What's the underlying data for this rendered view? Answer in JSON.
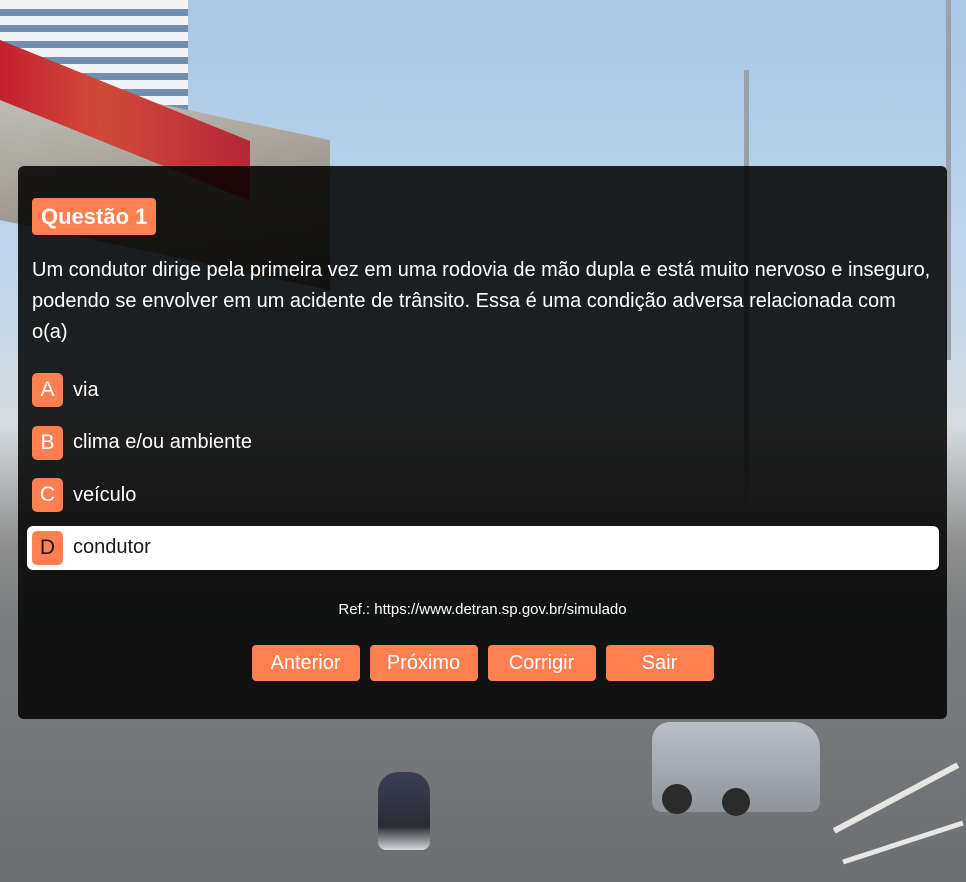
{
  "quiz": {
    "question_label": "Questão 1",
    "question_text": "Um condutor dirige pela primeira vez em uma rodovia de mão dupla e está muito nervoso e inseguro, podendo se envolver em um acidente de trânsito. Essa é uma condição adversa relacionada com o(a)",
    "options": [
      {
        "letter": "A",
        "text": "via"
      },
      {
        "letter": "B",
        "text": "clima e/ou ambiente"
      },
      {
        "letter": "C",
        "text": "veículo"
      },
      {
        "letter": "D",
        "text": "condutor"
      }
    ],
    "selected_option": "D",
    "reference": "Ref.: https://www.detran.sp.gov.br/simulado"
  },
  "buttons": {
    "previous": "Anterior",
    "next": "Próximo",
    "correct": "Corrigir",
    "exit": "Sair"
  },
  "colors": {
    "accent": "#ff7f50",
    "panel_background": "rgba(0,0,0,0.86)",
    "selected_option_background": "#ffffff"
  }
}
